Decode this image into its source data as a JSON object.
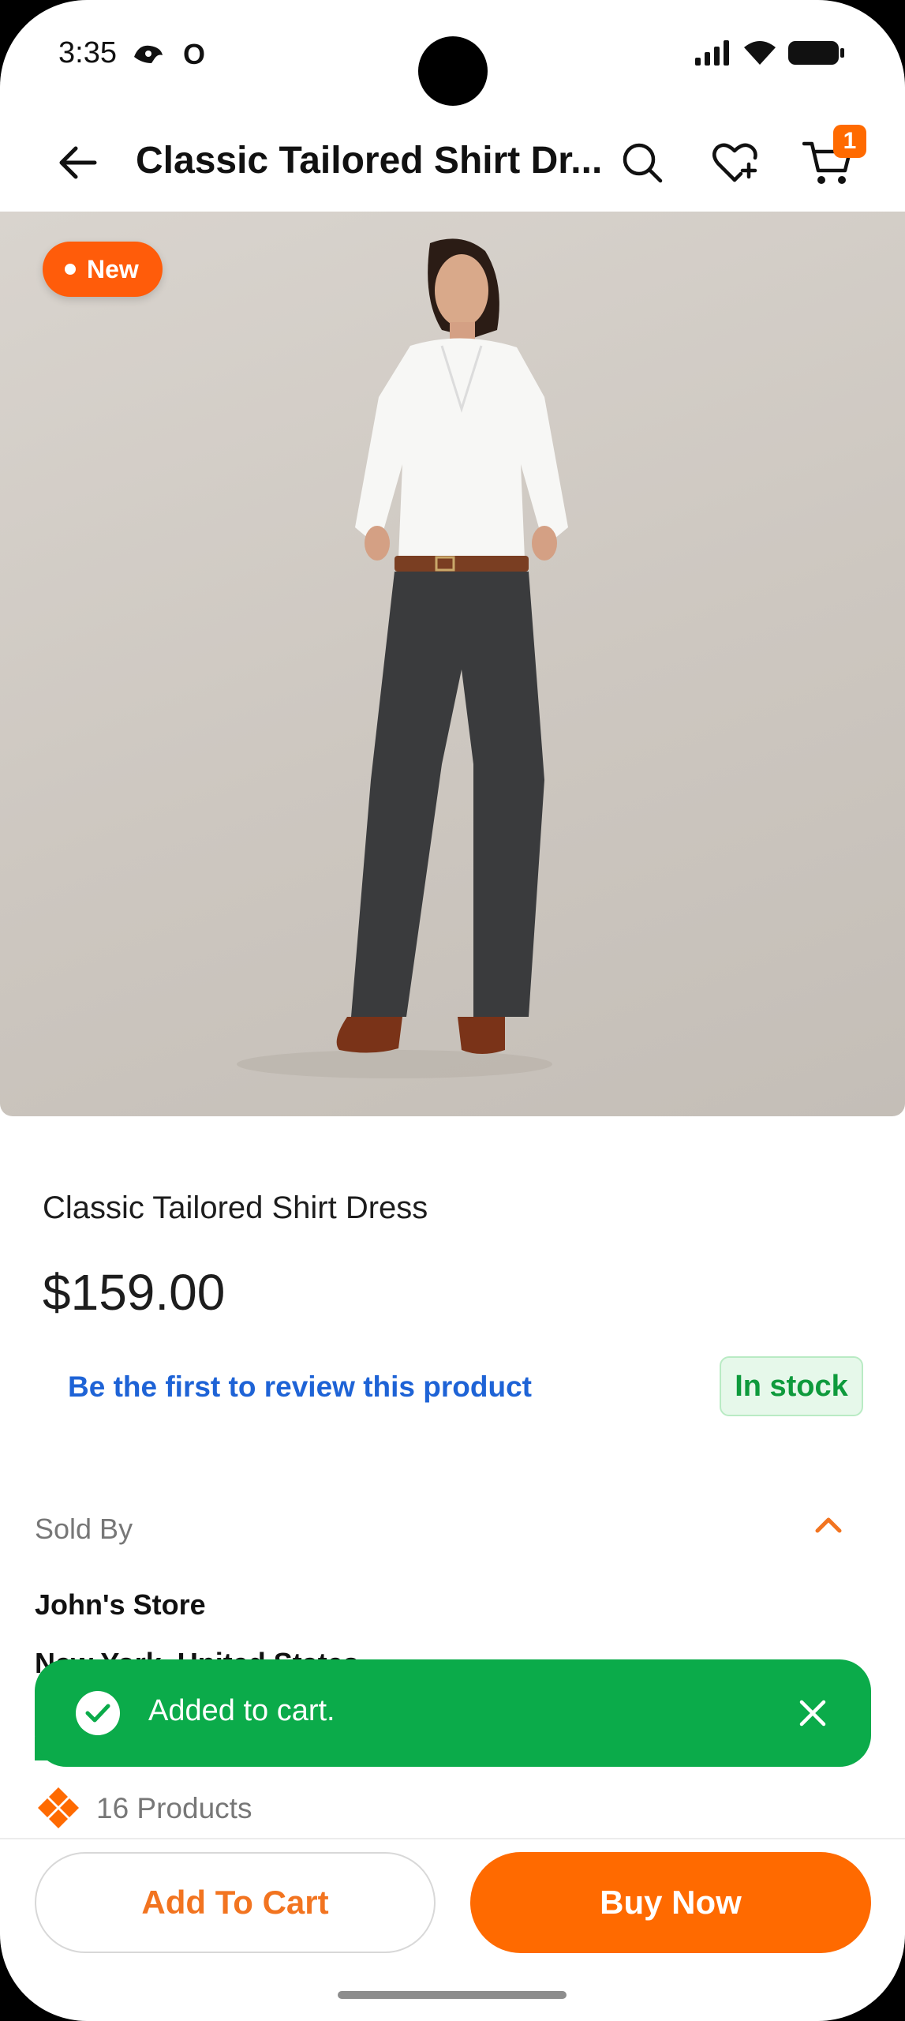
{
  "status_bar": {
    "time": "3:35",
    "extra": "O"
  },
  "header": {
    "title": "Classic Tailored Shirt Dr...",
    "cart_count": "1"
  },
  "product": {
    "badge": "New",
    "name": "Classic Tailored Shirt Dress",
    "price": "$159.00",
    "review_link": "Be the first to review this product",
    "stock": "In stock"
  },
  "seller": {
    "label": "Sold By",
    "name": "John's Store",
    "location": "New York, United States",
    "products": "16 Products"
  },
  "toast": {
    "message": "Added to cart."
  },
  "actions": {
    "add_to_cart": "Add To Cart",
    "buy_now": "Buy Now"
  },
  "colors": {
    "accent": "#ff6a00",
    "success": "#0bab4a",
    "link": "#1e63d6",
    "stock_text": "#0e9a3c"
  },
  "icons": [
    "back-arrow-icon",
    "search-icon",
    "heart-plus-icon",
    "cart-icon",
    "chevron-up-icon",
    "check-circle-icon",
    "close-icon",
    "store-icon"
  ]
}
